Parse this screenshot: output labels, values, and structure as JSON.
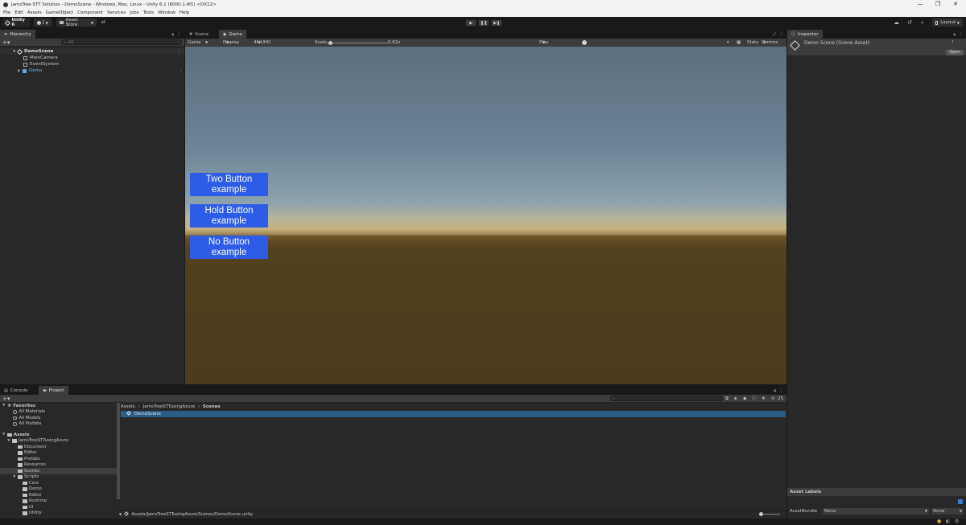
{
  "window": {
    "title": "JamsTree STT Solution - DemoScene - Windows, Mac, Linux - Unity 6.1 (6000.1.4f1) <DX12>",
    "controls": [
      "—",
      "❐",
      "✕"
    ]
  },
  "menu": [
    "File",
    "Edit",
    "Assets",
    "GameObject",
    "Component",
    "Services",
    "Jobs",
    "Tools",
    "Window",
    "Help"
  ],
  "toolbar": {
    "unity_label": "Unity 6",
    "account_label": "J",
    "asset_store_label": "Asset Store",
    "layout_label": "Layout"
  },
  "hierarchy": {
    "tab_label": "Hierarchy",
    "search_placeholder": "All",
    "scene_name": "DemoScene",
    "items": [
      {
        "label": "MainCamera"
      },
      {
        "label": "EventSystem"
      },
      {
        "label": "Demo"
      }
    ]
  },
  "game_view": {
    "tabs": [
      {
        "label": "Scene"
      },
      {
        "label": "Game"
      }
    ],
    "mode": "Game",
    "display": "Display 1",
    "resolution": "4K UHD (3840x2160)",
    "scale_label": "Scale",
    "scale_value": "0.62x",
    "play_focused": "Play Focused",
    "stats_label": "Stats",
    "gizmos_label": "Gizmos",
    "buttons": [
      {
        "line1": "Two Button",
        "line2": "example"
      },
      {
        "line1": "Hold Button",
        "line2": "example"
      },
      {
        "line1": "No Button",
        "line2": "example"
      }
    ],
    "button_color": "#2d5ce7"
  },
  "inspector": {
    "tab_label": "Inspector",
    "asset_title": "Demo Scene (Scene Asset)",
    "open_label": "Open",
    "asset_labels_title": "Asset Labels",
    "assetbundle_label": "AssetBundle",
    "assetbundle_value": "None",
    "variant_value": "None"
  },
  "project": {
    "tabs": [
      {
        "label": "Console"
      },
      {
        "label": "Project"
      }
    ],
    "favorites_label": "Favorites",
    "favorites": [
      "All Materials",
      "All Models",
      "All Prefabs"
    ],
    "assets_label": "Assets",
    "root_folder": "JamsTreeSTTusingAzure",
    "folders": [
      "Document",
      "Editor",
      "Prefabs",
      "Resources",
      "Scenes"
    ],
    "scripts_label": "Scripts",
    "script_folders": [
      "Core",
      "Demo",
      "Editor",
      "Runtime",
      "UI",
      "Utility"
    ],
    "breadcrumb": [
      "Assets",
      "JamsTreeSTTusingAzure",
      "Scenes"
    ],
    "selected_asset": "DemoScene",
    "footer_path": "Assets/JamsTreeSTTusingAzure/Scenes/DemoScene.unity",
    "item_count": "25"
  }
}
